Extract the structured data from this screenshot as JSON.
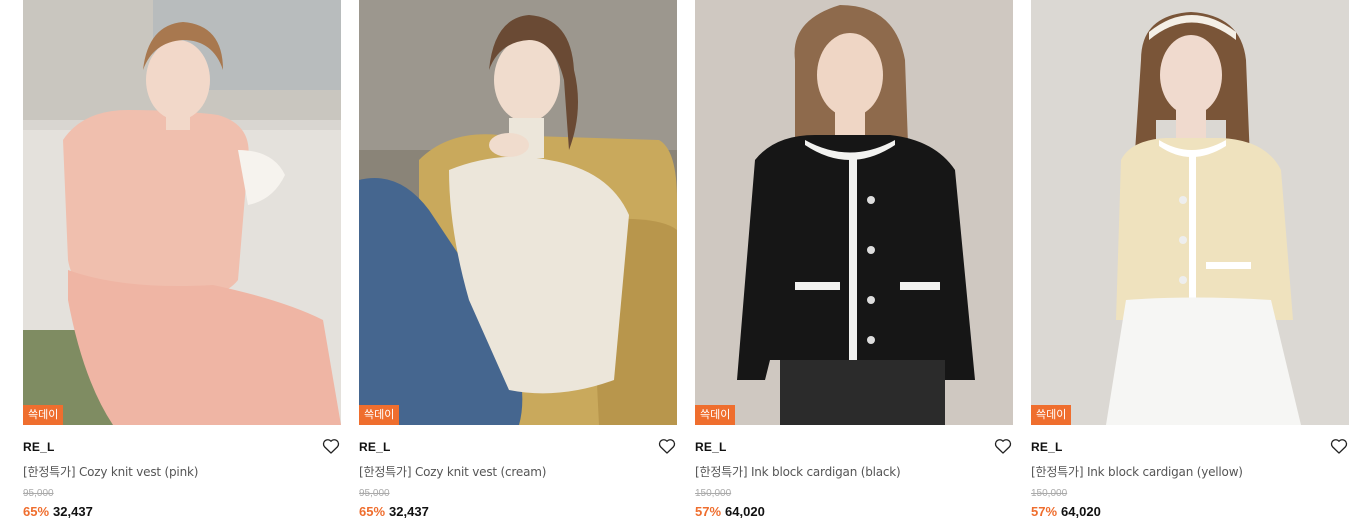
{
  "theme": {
    "accent": "#ef6e2e",
    "text": "#111111",
    "muted": "#aaaaaa"
  },
  "products": [
    {
      "image_icon": "product-photo-pink-knit-vest",
      "badge": "쓱데이",
      "brand": "RE_L",
      "name": "[한정특가] Cozy knit vest (pink)",
      "original_price": "95,000",
      "discount": "65%",
      "price": "32,437",
      "wish_icon": "heart-outline-icon"
    },
    {
      "image_icon": "product-photo-cream-knit-vest",
      "badge": "쓱데이",
      "brand": "RE_L",
      "name": "[한정특가] Cozy knit vest (cream)",
      "original_price": "95,000",
      "discount": "65%",
      "price": "32,437",
      "wish_icon": "heart-outline-icon"
    },
    {
      "image_icon": "product-photo-black-cardigan",
      "badge": "쓱데이",
      "brand": "RE_L",
      "name": "[한정특가] Ink block cardigan (black)",
      "original_price": "150,000",
      "discount": "57%",
      "price": "64,020",
      "wish_icon": "heart-outline-icon"
    },
    {
      "image_icon": "product-photo-yellow-cardigan",
      "badge": "쓱데이",
      "brand": "RE_L",
      "name": "[한정특가] Ink block cardigan (yellow)",
      "original_price": "150,000",
      "discount": "57%",
      "price": "64,020",
      "wish_icon": "heart-outline-icon"
    }
  ]
}
